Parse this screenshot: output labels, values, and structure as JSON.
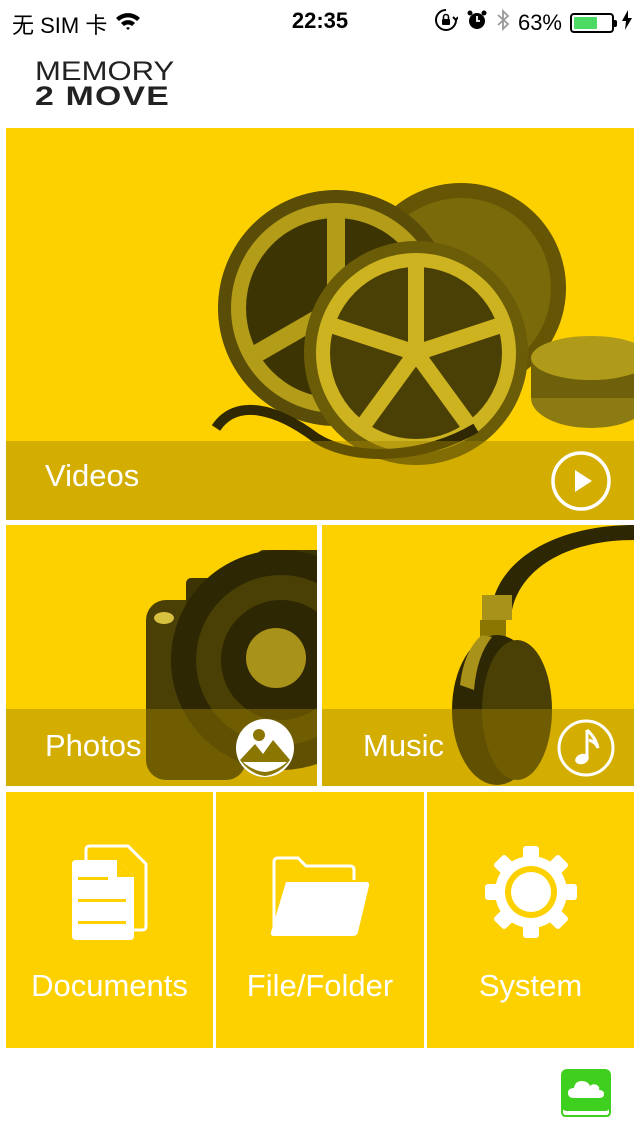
{
  "status_bar": {
    "carrier": "无 SIM 卡",
    "time": "22:35",
    "battery_percent": "63%",
    "battery_level": 0.63,
    "icons": [
      "wifi-icon",
      "orientation-lock-icon",
      "alarm-icon",
      "bluetooth-icon",
      "battery-icon",
      "charging-icon"
    ]
  },
  "logo": {
    "line1": "MEMORY",
    "line2": "2 MOVE"
  },
  "tiles": {
    "videos": {
      "label": "Videos",
      "icon": "play-circle-icon"
    },
    "photos": {
      "label": "Photos",
      "icon": "photo-circle-icon"
    },
    "music": {
      "label": "Music",
      "icon": "music-note-circle-icon"
    },
    "documents": {
      "label": "Documents",
      "icon": "documents-icon"
    },
    "files": {
      "label": "File/Folder",
      "icon": "folder-icon"
    },
    "system": {
      "label": "System",
      "icon": "gear-icon"
    }
  },
  "footer": {
    "cloud_icon": "cloud-drive-icon"
  },
  "colors": {
    "tile_yellow": "#fdd000",
    "overlay": "#c9a800",
    "battery_green": "#4cd964",
    "cloud_green": "#3fcf1e"
  }
}
